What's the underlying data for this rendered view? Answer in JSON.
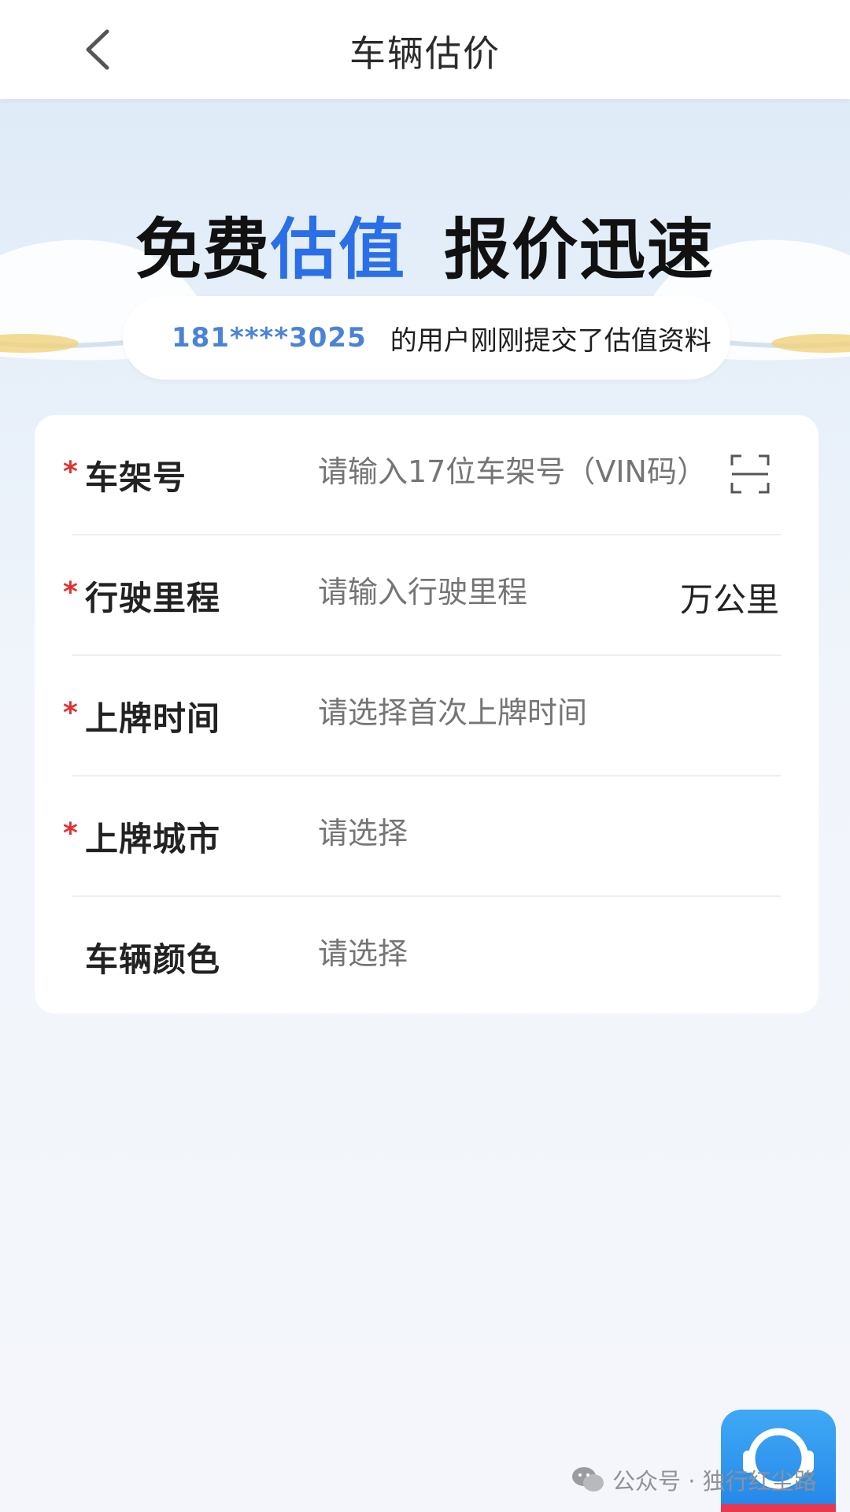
{
  "header": {
    "title": "车辆估价"
  },
  "hero": {
    "headline_part1": "免费",
    "headline_part2": "估值",
    "headline_part3": "报价迅速",
    "ticker_phone": "181****3025",
    "ticker_text": "的用户刚刚提交了估值资料"
  },
  "form": {
    "rows": [
      {
        "required": true,
        "label": "车架号",
        "placeholder": "请输入17位车架号（VIN码）",
        "action_icon": "scan-icon"
      },
      {
        "required": true,
        "label": "行驶里程",
        "placeholder": "请输入行驶里程",
        "unit": "万公里"
      },
      {
        "required": true,
        "label": "上牌时间",
        "placeholder": "请选择首次上牌时间"
      },
      {
        "required": true,
        "label": "上牌城市",
        "placeholder": "请选择"
      },
      {
        "required": false,
        "label": "车辆颜色",
        "placeholder": "请选择"
      }
    ],
    "required_mark": "*"
  },
  "watermark": {
    "text": "公众号 · 独行红尘路",
    "icon": "wechat-icon"
  },
  "floating": {
    "icon": "customer-service-icon"
  },
  "colors": {
    "accent_blue": "#2a6fe8",
    "phone_blue": "#4a83d8",
    "required_red": "#e03131",
    "placeholder_gray": "#b8b8b8"
  }
}
